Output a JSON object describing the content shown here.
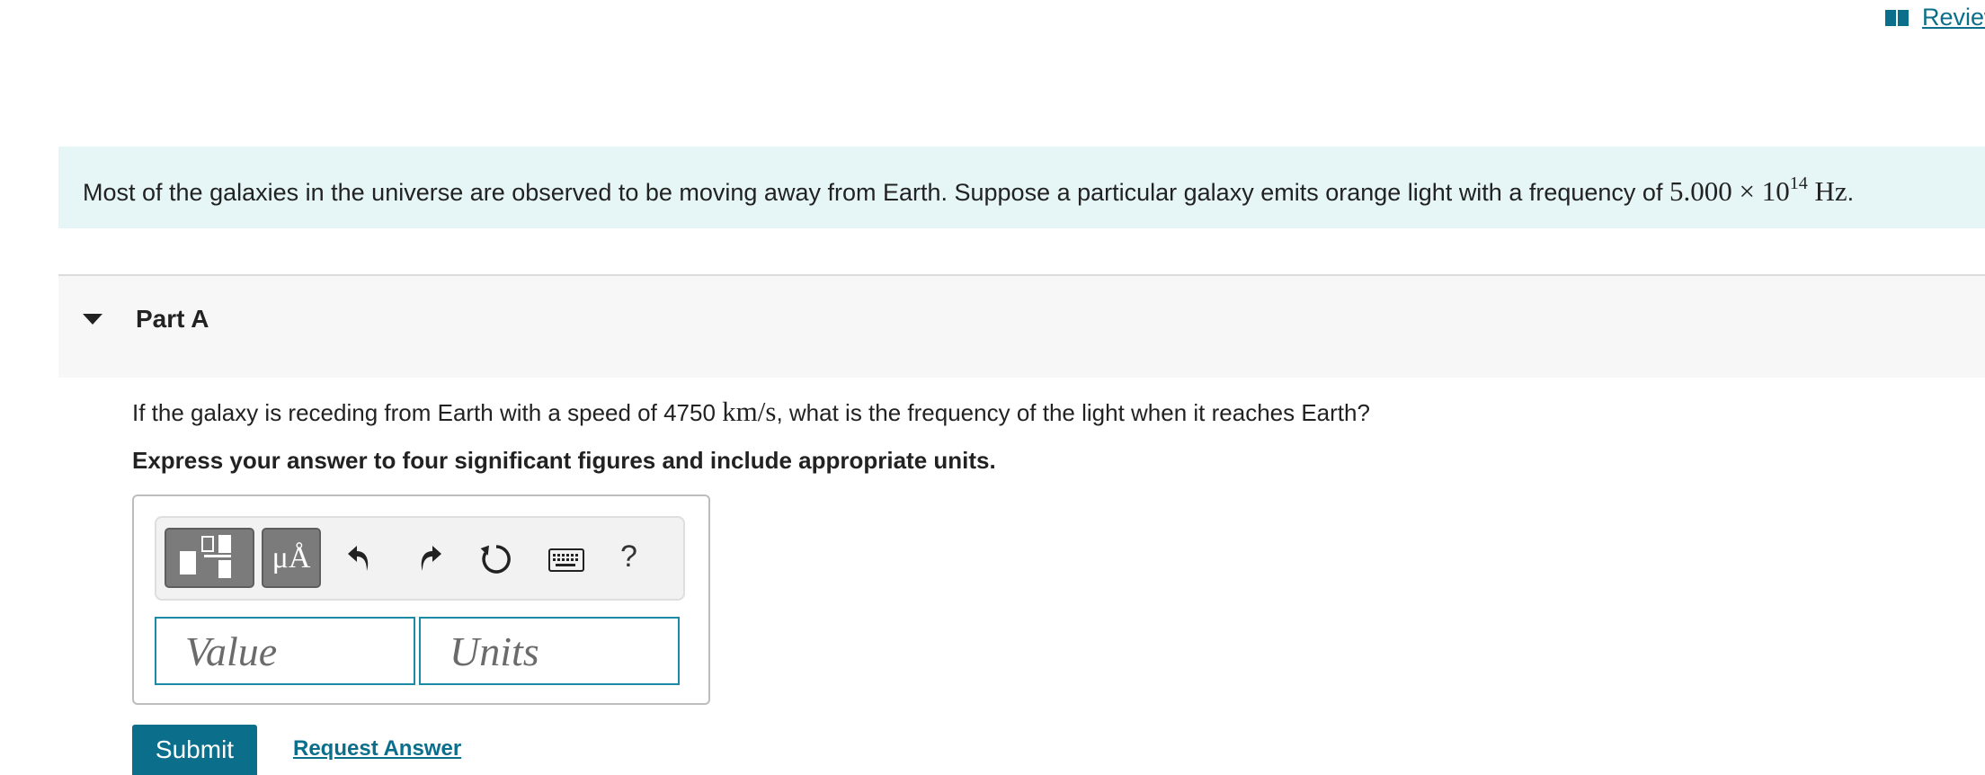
{
  "header": {
    "review_label": "Review"
  },
  "intro": {
    "text": "Most of the galaxies in the universe are observed to be moving away from Earth. Suppose a particular galaxy emits orange light with a frequency of",
    "freq_mantissa": "5.000",
    "times": "×",
    "base": "10",
    "exponent": "14",
    "unit": "Hz",
    "end": "."
  },
  "part": {
    "title": "Part A",
    "expanded": true
  },
  "question": {
    "prefix": "If the galaxy is receding from Earth with a speed of 4750",
    "speed_unit": "km/s",
    "suffix": ", what is the frequency of the light when it reaches Earth?",
    "instruction": "Express your answer to four significant figures and include appropriate units."
  },
  "toolbar": {
    "symbols_label": "μÅ",
    "help_label": "?",
    "icons": [
      "templates-icon",
      "symbols-icon",
      "undo-icon",
      "redo-icon",
      "reset-icon",
      "keyboard-icon",
      "help-icon"
    ]
  },
  "inputs": {
    "value_placeholder": "Value",
    "value": "",
    "units_placeholder": "Units",
    "units": ""
  },
  "actions": {
    "submit_label": "Submit",
    "request_label": "Request Answer"
  },
  "colors": {
    "accent": "#0b6e8a",
    "intro_bg": "#e6f6f6",
    "part_bg": "#f7f7f7",
    "input_border": "#1b8ba5"
  }
}
